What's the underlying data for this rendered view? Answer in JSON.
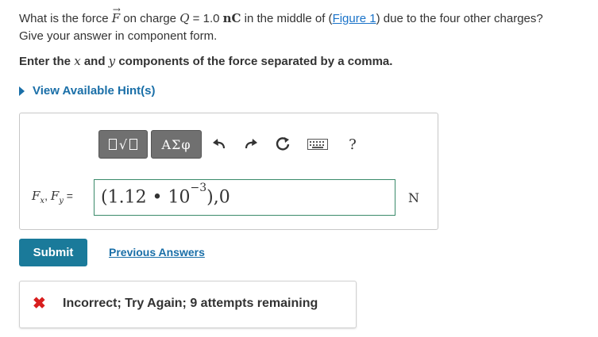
{
  "question": {
    "line1_pre": "What is the force ",
    "force_symbol": "F",
    "line1_mid": " on charge ",
    "charge_symbol": "Q",
    "charge_value": " = 1.0 ",
    "charge_unit": "nC",
    "line1_post": " in the middle of (",
    "figure_link": "Figure 1",
    "line1_end": ") due to the four other charges?",
    "line2": "Give your answer in component form."
  },
  "instruction": {
    "pre": "Enter the ",
    "x": "x",
    "mid": " and ",
    "y": "y",
    "post": " components of the force separated by a comma."
  },
  "hint": {
    "label": "View Available Hint(s)"
  },
  "toolbar": {
    "templates_radical": "√",
    "greek_label": "ΑΣφ",
    "help_label": "?"
  },
  "answer": {
    "label_fx": "F",
    "sub_x": "x",
    "comma": ", ",
    "label_fy": "F",
    "sub_y": "y",
    "equals": " = ",
    "value_main": "(1.12 • 10",
    "value_exp": "−3",
    "value_tail": "),0",
    "unit": "N"
  },
  "actions": {
    "submit_label": "Submit",
    "previous_answers_label": "Previous Answers"
  },
  "feedback": {
    "icon": "✖",
    "message": "Incorrect; Try Again; 9 attempts remaining"
  },
  "colors": {
    "link": "#1a6fa8",
    "submit_bg": "#1a7a9a",
    "error": "#d81e1e",
    "toolbar_btn": "#707070"
  }
}
